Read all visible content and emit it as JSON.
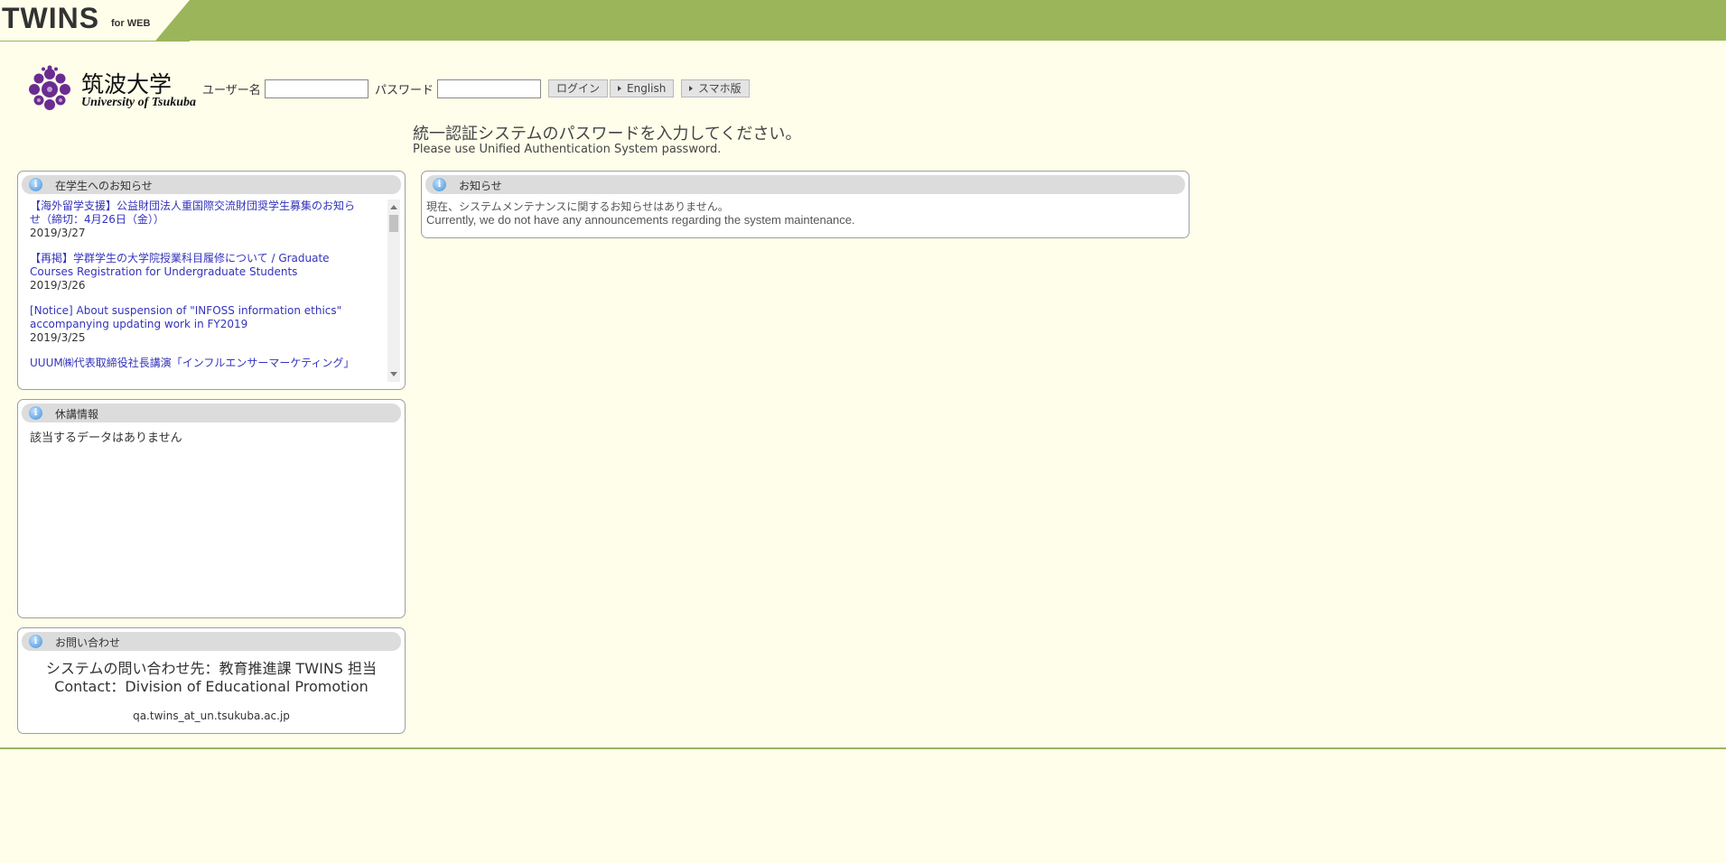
{
  "header": {
    "brand": "TWINS",
    "brand_sub": "for WEB"
  },
  "logo": {
    "ja": "筑波大学",
    "en": "University of Tsukuba"
  },
  "login": {
    "username_label": "ユーザー名",
    "username_value": "",
    "password_label": "パスワード",
    "password_value": "",
    "login_button": "ログイン",
    "english_button": "English",
    "smartphone_button": "スマホ版"
  },
  "instructions": {
    "ja": "統一認証システムのパスワードを入力してください。",
    "en": "Please use Unified Authentication System password."
  },
  "student_news": {
    "title": "在学生へのお知らせ",
    "items": [
      {
        "title": "【海外留学支援】公益財団法人重国際交流財団奨学生募集のお知らせ（締切：4月26日（金））",
        "date": "2019/3/27"
      },
      {
        "title": "【再掲】学群学生の大学院授業科目履修について / Graduate Courses Registration for Undergraduate Students",
        "date": "2019/3/26"
      },
      {
        "title": "[Notice] About suspension of \"INFOSS information ethics\" accompanying updating work in FY2019",
        "date": "2019/3/25"
      },
      {
        "title": "UUUM㈱代表取締役社長講演「インフルエンサーマーケティング」",
        "date": ""
      }
    ]
  },
  "cancellations": {
    "title": "休講情報",
    "empty_text": "該当するデータはありません"
  },
  "contact": {
    "title": "お問い合わせ",
    "ja": "システムの問い合わせ先：教育推進課 TWINS 担当",
    "en": "Contact：Division of Educational Promotion",
    "email": "qa.twins_at_un.tsukuba.ac.jp"
  },
  "notices": {
    "title": "お知らせ",
    "ja": "現在、システムメンテナンスに関するお知らせはありません。",
    "en": "Currently, we do not have any announcements regarding the system maintenance."
  },
  "colors": {
    "header_green": "#9bb55a",
    "background": "#fefeeb",
    "link": "#3333bb",
    "logo_purple": "#6a2c91"
  },
  "icons": [
    "info-icon",
    "university-crest-icon",
    "triangle-right-icon"
  ]
}
